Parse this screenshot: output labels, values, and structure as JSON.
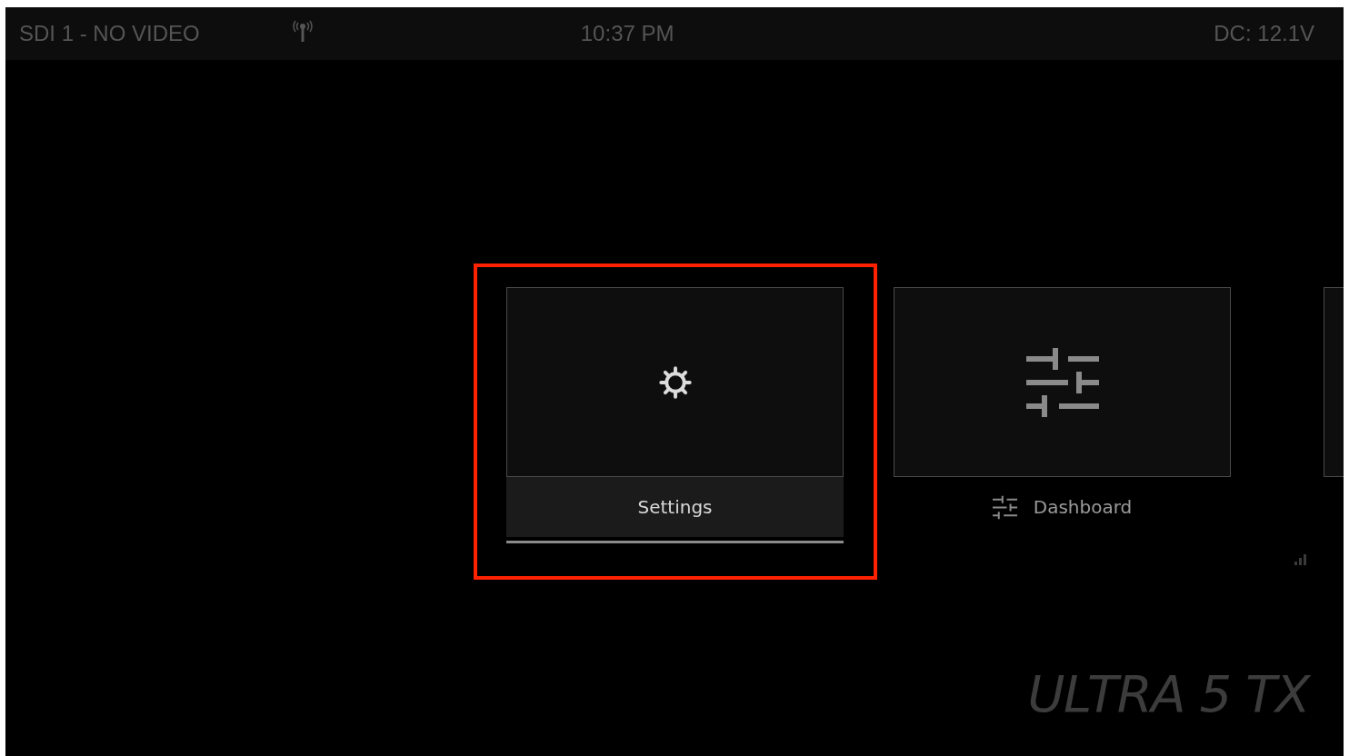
{
  "status_bar": {
    "source": "SDI 1 - NO VIDEO",
    "time": "10:37 PM",
    "power": "DC: 12.1V"
  },
  "tiles": [
    {
      "kind": "gear",
      "label": "Settings",
      "selected": true
    },
    {
      "kind": "sliders",
      "label": "Dashboard",
      "selected": false
    },
    {
      "kind": "blank",
      "selected": false
    }
  ],
  "logo": "ULTRA 5 TX"
}
